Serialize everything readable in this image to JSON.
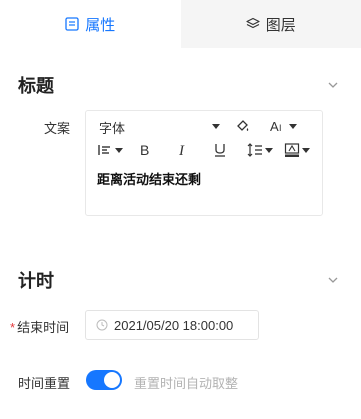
{
  "tabs": [
    {
      "label": "属性",
      "icon": "list-icon",
      "active": true
    },
    {
      "label": "图层",
      "icon": "layers-icon",
      "active": false
    }
  ],
  "section_title": {
    "label": "标题",
    "icon": "chevron-down-icon"
  },
  "copy_field": {
    "label": "文案",
    "toolbar": {
      "font_label": "字体",
      "icons": [
        "fill-color-icon",
        "font-size-icon",
        "align-icon",
        "bold-icon",
        "italic-icon",
        "underline-icon",
        "line-height-icon",
        "background-color-icon"
      ]
    },
    "content": "距离活动结束还剩"
  },
  "timer_section": {
    "label": "计时",
    "icon": "chevron-down-icon"
  },
  "end_time": {
    "label": "结束时间",
    "required_mark": "*",
    "value": "2021/05/20 18:00:00",
    "icon": "clock-icon"
  },
  "time_reset": {
    "label": "时间重置",
    "toggle_on": true,
    "toggle_text": "重置时间自动取整"
  },
  "colors": {
    "accent": "#1677ff",
    "required": "#e4393c",
    "tab_inactive_bg": "#f5f5f5"
  }
}
